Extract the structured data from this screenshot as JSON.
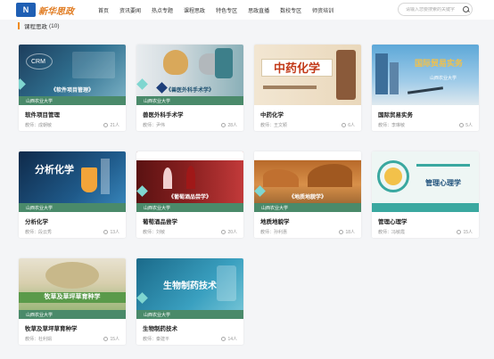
{
  "brand": {
    "mark": "N",
    "name": "新华思政"
  },
  "nav": [
    "首页",
    "资讯要闻",
    "热点专题",
    "课程思政",
    "特色专区",
    "思政直播",
    "数校专区",
    "师资培训"
  ],
  "search": {
    "placeholder": "请输入您要搜索的关键字"
  },
  "section": {
    "title": "课程思政",
    "count": "(10)"
  },
  "courses": [
    {
      "name": "软件项目管理",
      "teacher": "教师：成朝敏",
      "students": "21人",
      "cover_title": "《软件项目管理》",
      "cover_school": "山西农业大学"
    },
    {
      "name": "兽医外科手术学",
      "teacher": "教师：尹伟",
      "students": "28人",
      "cover_title": "《兽医外科手术学》",
      "cover_school": "山西农业大学"
    },
    {
      "name": "中药化学",
      "teacher": "教师：王文颖",
      "students": "6人",
      "cover_title": "中药化学",
      "cover_school": ""
    },
    {
      "name": "国际贸易实务",
      "teacher": "教师：李琳敏",
      "students": "5人",
      "cover_title": "国际贸易实务",
      "cover_school": "山西农业大学"
    },
    {
      "name": "分析化学",
      "teacher": "教师：段云秀",
      "students": "13人",
      "cover_title": "分析化学",
      "cover_school": "山西农业大学"
    },
    {
      "name": "葡萄酒品尝学",
      "teacher": "教师：刘敏",
      "students": "20人",
      "cover_title": "《葡萄酒品尝学》",
      "cover_school": "山西农业大学"
    },
    {
      "name": "地质地貌学",
      "teacher": "教师：孙利惠",
      "students": "18人",
      "cover_title": "《地质地貌学》",
      "cover_school": "山西农业大学"
    },
    {
      "name": "管理心理学",
      "teacher": "教师：冯敏霞",
      "students": "15人",
      "cover_title": "管理心理学",
      "cover_school": ""
    },
    {
      "name": "牧草及草坪草育种学",
      "teacher": "教师：杜利娟",
      "students": "15人",
      "cover_title": "牧草及草坪草育种学",
      "cover_school": "山西农业大学"
    },
    {
      "name": "生物制药技术",
      "teacher": "教师：秦建平",
      "students": "14人",
      "cover_title": "生物制药技术",
      "cover_school": "山西农业大学"
    }
  ],
  "colors": {
    "accent": "#f08c1e",
    "band": "#4a8a6a",
    "brand_blue": "#1f5fb4"
  }
}
